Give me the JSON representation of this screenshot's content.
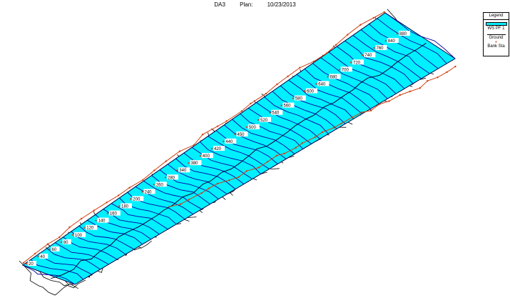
{
  "header": {
    "plot_name": "DA3",
    "plan_label": "Plan:",
    "plan_date": "10/23/2013"
  },
  "legend": {
    "title": "Legend",
    "ws_label": "WS PF 1",
    "ground_label": "Ground",
    "bank_label": "Bank Sta"
  },
  "stations": [
    "20",
    "40",
    "60",
    "80",
    "100",
    "120",
    "140",
    "160",
    "180",
    "200",
    "240",
    "260",
    "280",
    "340",
    "380",
    "400",
    "420",
    "440",
    "450",
    "500",
    "520",
    "540",
    "560",
    "580",
    "600",
    "640",
    "680",
    "700",
    "720",
    "740",
    "760",
    "840",
    "880"
  ],
  "colors": {
    "water_surface": "#00f0ff",
    "ws_lines": "#0000a0",
    "ground": "#000000",
    "bank": "#d04010"
  }
}
